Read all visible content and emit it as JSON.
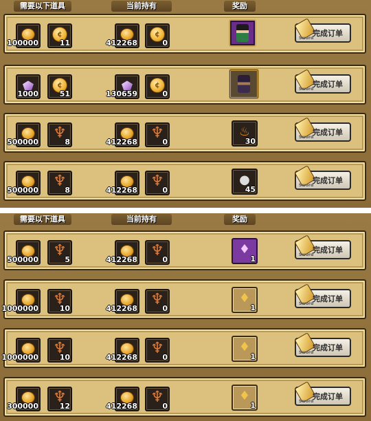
{
  "headers": {
    "required": "需要以下道具",
    "current": "当前持有",
    "reward": "奖励"
  },
  "button": {
    "label": "完成订单",
    "sub": "Sword"
  },
  "icons": {
    "coin": "coin-icon",
    "gold_medal": "gold-medal-icon",
    "gem": "gem-icon",
    "wing": "wing-icon"
  },
  "colors": {
    "panel": "#8f6f3a",
    "card": "#dcc07e",
    "slot": "#2a211a"
  },
  "top_orders": [
    {
      "req1": "100000",
      "req2": "11",
      "have1": "412268",
      "have2": "0",
      "reward_qty": ""
    },
    {
      "req1": "1000",
      "req2": "51",
      "have1": "130659",
      "have2": "0",
      "reward_qty": ""
    },
    {
      "req1": "500000",
      "req2": "8",
      "have1": "412268",
      "have2": "0",
      "reward_qty": "30"
    },
    {
      "req1": "500000",
      "req2": "8",
      "have1": "412268",
      "have2": "0",
      "reward_qty": "45"
    }
  ],
  "bottom_orders": [
    {
      "req1": "500000",
      "req2": "5",
      "have1": "412268",
      "have2": "0",
      "reward_qty": "1"
    },
    {
      "req1": "1000000",
      "req2": "10",
      "have1": "412268",
      "have2": "0",
      "reward_qty": "1"
    },
    {
      "req1": "1000000",
      "req2": "10",
      "have1": "412268",
      "have2": "0",
      "reward_qty": "1"
    },
    {
      "req1": "300000",
      "req2": "12",
      "have1": "412268",
      "have2": "0",
      "reward_qty": "1"
    }
  ]
}
